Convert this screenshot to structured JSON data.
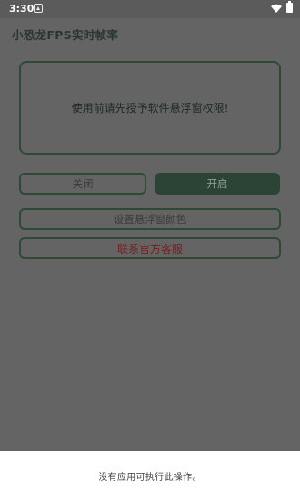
{
  "status_bar": {
    "time": "3:30",
    "icons": [
      "notification-icon",
      "wifi-icon",
      "battery-icon"
    ]
  },
  "app": {
    "title": "小恐龙FPS实时帧率",
    "permission_message": "使用前请先授予软件悬浮窗权限!",
    "buttons": {
      "close": "关闭",
      "open": "开启",
      "set_color": "设置悬浮窗颜色",
      "contact_support": "联系官方客服"
    }
  },
  "dialog": {
    "message": "没有应用可执行此操作。"
  },
  "colors": {
    "scrim_bg": "#646464",
    "accent_green": "#2c4436",
    "support_text": "#7a1d1d"
  }
}
